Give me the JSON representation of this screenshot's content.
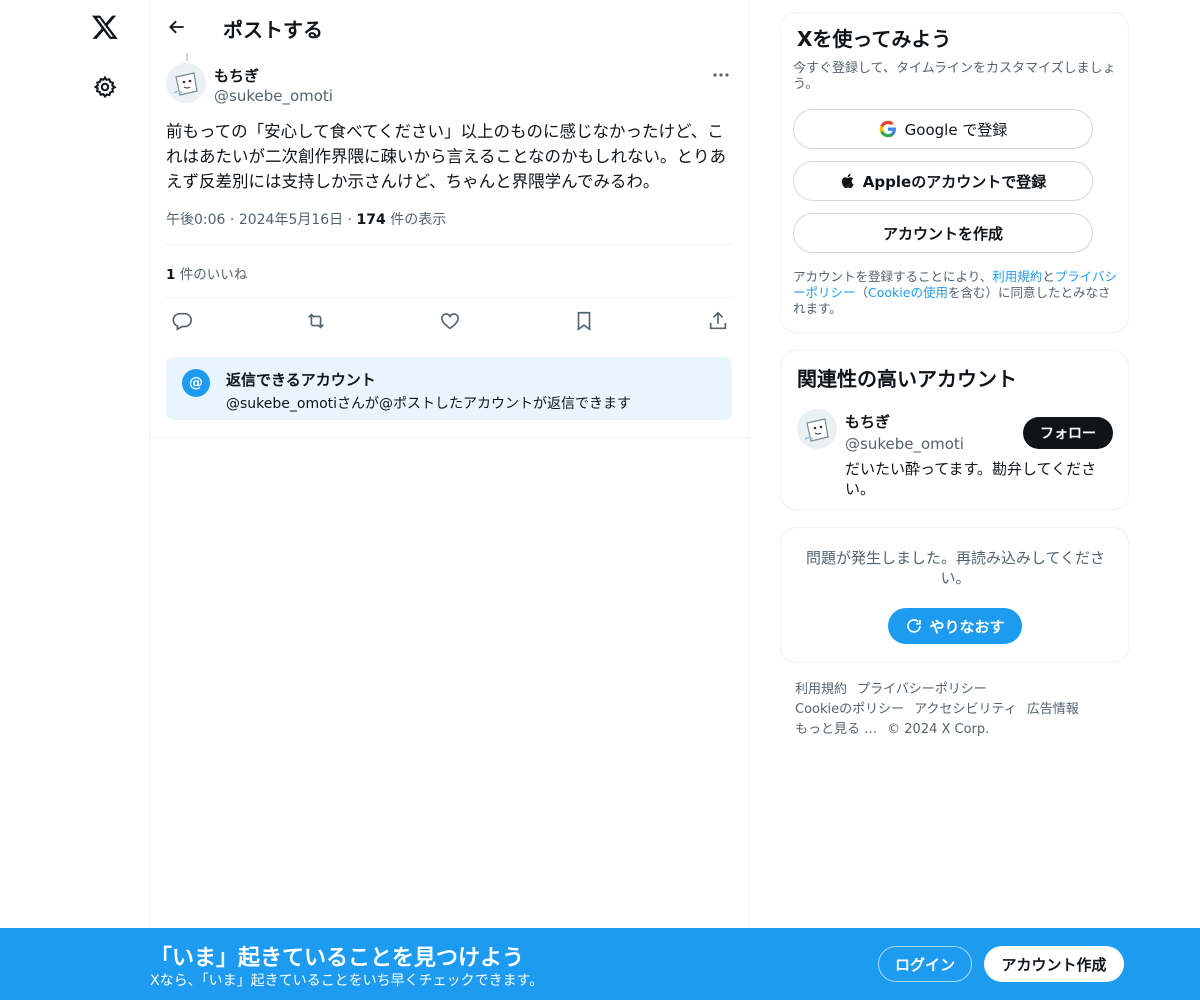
{
  "nav": {
    "logo_icon": "x-logo-icon",
    "settings_icon": "gear-icon"
  },
  "header": {
    "title": "ポストする"
  },
  "post": {
    "author_name": "もちぎ",
    "author_handle": "@sukebe_omoti",
    "text": "前もっての「安心して食べてください」以上のものに感じなかったけど、これはあたいが二次創作界隈に疎いから言えることなのかもしれない。とりあえず反差別には支持しか示さんけど、ちゃんと界隈学んでみるわ。",
    "time": "午後0:06",
    "date": "2024年5月16日",
    "views_count": "174",
    "views_label": "件の表示",
    "likes_count": "1",
    "likes_label": "件のいいね",
    "reply_note_title": "返信できるアカウント",
    "reply_note_desc": "@sukebe_omotiさんが@ポストしたアカウントが返信できます"
  },
  "signup": {
    "title": "Xを使ってみよう",
    "subtitle": "今すぐ登録して、タイムラインをカスタマイズしましょう。",
    "google_label": "Google で登録",
    "apple_label": "Appleのアカウントで登録",
    "create_label": "アカウントを作成",
    "legal_prefix": "アカウントを登録することにより、",
    "legal_terms": "利用規約",
    "legal_and": "と",
    "legal_privacy": "プライバシーポリシー",
    "legal_open": "（",
    "legal_cookie": "Cookieの使用",
    "legal_suffix": "を含む）に同意したとみなされます。"
  },
  "related": {
    "title": "関連性の高いアカウント",
    "name": "もちぎ",
    "handle": "@sukebe_omoti",
    "bio": "だいたい酔ってます。勘弁してください。",
    "follow_label": "フォロー"
  },
  "error": {
    "message": "問題が発生しました。再読み込みしてください。",
    "retry_label": "やりなおす"
  },
  "footer": {
    "links": [
      "利用規約",
      "プライバシーポリシー",
      "Cookieのポリシー",
      "アクセシビリティ",
      "広告情報",
      "もっと見る …",
      "© 2024 X Corp."
    ]
  },
  "banner": {
    "title": "「いま」起きていることを見つけよう",
    "subtitle": "Xなら、「いま」起きていることをいち早くチェックできます。",
    "login_label": "ログイン",
    "signup_label": "アカウント作成"
  },
  "colors": {
    "accent": "#1d9bf0",
    "text": "#0f1419",
    "muted": "#536471",
    "border": "#eff3f4"
  }
}
